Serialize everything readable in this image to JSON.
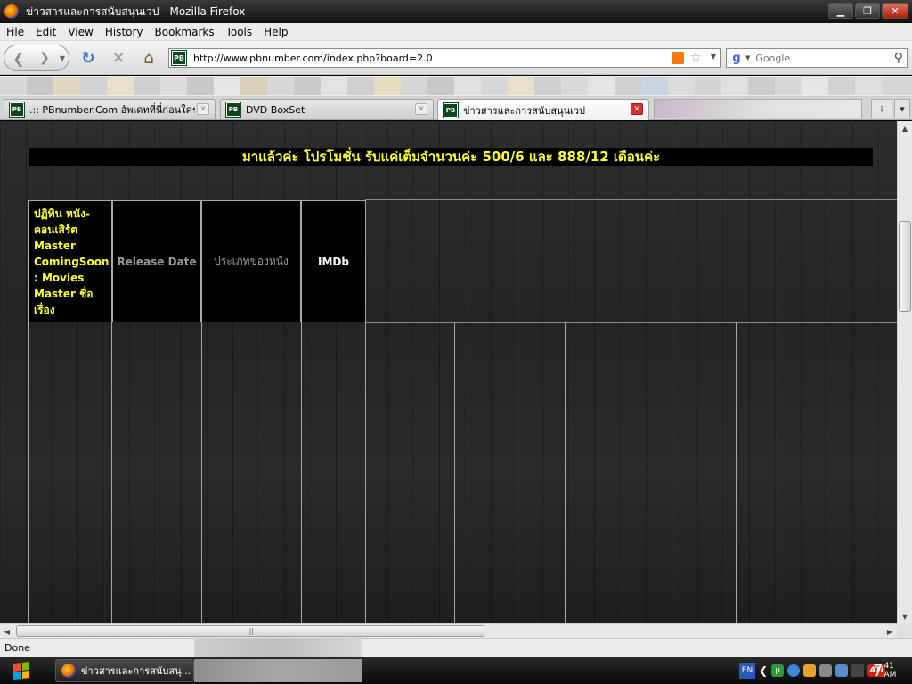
{
  "window": {
    "title": "ข่าวสารและการสนับสนุนเวป - Mozilla Firefox",
    "minimize": "▁",
    "maximize": "❐",
    "close": "✕"
  },
  "menu": [
    "File",
    "Edit",
    "View",
    "History",
    "Bookmarks",
    "Tools",
    "Help"
  ],
  "nav": {
    "url": "http://www.pbnumber.com/index.php?board=2.0",
    "search_placeholder": "Google",
    "site_badge": "PB"
  },
  "tabs": [
    {
      "label": ".:: PBnumber.Com อัพเดทที่นี่ก่อนใคร ...",
      "active": false
    },
    {
      "label": "DVD BoxSet",
      "active": false
    },
    {
      "label": "ข่าวสารและการสนับสนุนเวป",
      "active": true
    }
  ],
  "tab_close": "✕",
  "tab_list_button": "⁝",
  "content": {
    "promo": "มาแล้วค่ะ โปรโมชั่น รับแค่เต็มจำนวนค่ะ 500/6 และ 888/12 เดือนค่ะ",
    "headers": {
      "col1": "ปฏิทิน หนัง-คอนเสิร์ต Master ComingSoon : Movies Master ชื่อเรื่อง",
      "col2": "Release Date",
      "col3": "ประเภทของหนัง",
      "col4": "IMDb"
    }
  },
  "status": {
    "text": "Done"
  },
  "taskbar": {
    "task_label": "ข่าวสารและการสนับสนุ...",
    "lang": "EN",
    "clock_hour": "7",
    "clock_min": "41",
    "clock_ampm": "AM"
  },
  "colors": {
    "promo_text": "#ffff33",
    "header_yellow": "#ffff33",
    "header_gray": "#9a9a9a",
    "active_tab_close": "#d8302a"
  }
}
